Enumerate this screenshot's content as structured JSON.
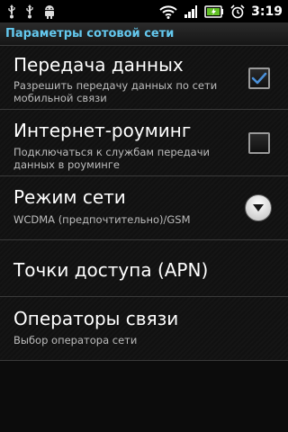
{
  "status_bar": {
    "clock": "3:19",
    "left_icons": [
      "usb-icon",
      "usb-icon",
      "android-debug-icon"
    ],
    "right_icons": [
      "wifi-icon",
      "signal-icon",
      "battery-icon",
      "alarm-icon"
    ]
  },
  "header": {
    "title": "Параметры сотовой сети"
  },
  "settings": {
    "items": [
      {
        "title": "Передача данных",
        "subtitle": "Разрешить передачу данных по сети мобильной связи",
        "control": "checkbox",
        "checked": true
      },
      {
        "title": "Интернет-роуминг",
        "subtitle": "Подключаться к службам передачи данных в роуминге",
        "control": "checkbox",
        "checked": false
      },
      {
        "title": "Режим сети",
        "subtitle": "WCDMA (предпочтительно)/GSM",
        "control": "dropdown"
      },
      {
        "title": "Точки доступа (APN)",
        "subtitle": "",
        "control": "none"
      },
      {
        "title": "Операторы связи",
        "subtitle": "Выбор оператора сети",
        "control": "none"
      }
    ]
  },
  "colors": {
    "accent": "#64c8ee",
    "checkmark": "#4a90d9",
    "background": "#0c0c0c"
  }
}
